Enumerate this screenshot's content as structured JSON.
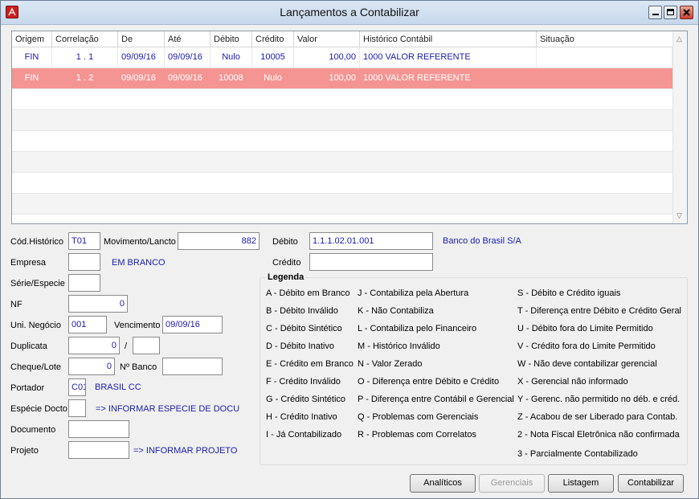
{
  "window": {
    "title": "Lançamentos a Contabilizar"
  },
  "grid": {
    "columns": [
      "Origem",
      "Correlação",
      "De",
      "Até",
      "Débito",
      "Crédito",
      "Valor",
      "Histórico Contábil",
      "Situação"
    ],
    "rows": [
      {
        "origem": "FIN",
        "correlacao": "1 . 1",
        "de": "09/09/16",
        "ate": "09/09/16",
        "debito": "Nulo",
        "credito": "10005",
        "valor": "100,00",
        "historico": "1000  VALOR REFERENTE",
        "situacao": ""
      },
      {
        "origem": "FIN",
        "correlacao": "1      . 2",
        "de": "09/09/16",
        "ate": "09/09/16",
        "debito": "10008",
        "credito": "Nulo",
        "valor": "100,00",
        "historico": "1000  VALOR REFERENTE",
        "situacao": ""
      }
    ]
  },
  "form": {
    "cod_historico": {
      "label": "Cód.Histórico",
      "value": "T01"
    },
    "movimento_lancto": {
      "label": "Movimento/Lancto",
      "value": "882"
    },
    "debito": {
      "label": "Débito",
      "value": "1.1.1.02.01.001",
      "desc": "Banco do Brasil S/A"
    },
    "credito": {
      "label": "Crédito",
      "value": ""
    },
    "empresa": {
      "label": "Empresa",
      "value": "",
      "desc": "EM BRANCO"
    },
    "serie_especie": {
      "label": "Série/Especie",
      "value": ""
    },
    "nf": {
      "label": "NF",
      "value": "0"
    },
    "uni_negocio": {
      "label": "Uni. Negócio",
      "value": "001"
    },
    "vencimento": {
      "label": "Vencimento",
      "value": "09/09/16"
    },
    "duplicata": {
      "label": "Duplicata",
      "value": "0",
      "slash": "/",
      "value2": ""
    },
    "cheque_lote": {
      "label": "Cheque/Lote",
      "value": "0"
    },
    "n_banco": {
      "label": "Nº Banco",
      "value": ""
    },
    "portador": {
      "label": "Portador",
      "value": "C01",
      "desc": "BRASIL CC"
    },
    "especie_docto": {
      "label": "Espécie Docto",
      "value": "",
      "desc": "=> INFORMAR ESPECIE DE DOCU"
    },
    "documento": {
      "label": "Documento",
      "value": ""
    },
    "projeto": {
      "label": "Projeto",
      "value": "",
      "desc": "=> INFORMAR PROJETO"
    }
  },
  "legend": {
    "title": "Legenda",
    "col1": [
      "A - Débito em Branco",
      "B - Débito Inválido",
      "C - Débito Sintético",
      "D - Débito Inativo",
      "E - Crédito em Branco",
      "F - Crédito Inválido",
      "G - Crédito Sintético",
      "H - Crédito Inativo",
      "I - Já Contabilizado"
    ],
    "col2": [
      "J - Contabiliza pela Abertura",
      "K - Não Contabiliza",
      "L - Contabiliza pelo Financeiro",
      "M - Histórico Inválido",
      "N - Valor Zerado",
      "O - Diferença entre Débito e Crédito",
      "P - Diferença entre Contábil e Gerencial",
      "Q - Problemas com Gerenciais",
      "R - Problemas com Correlatos"
    ],
    "col3": [
      "S - Débito e Crédito iguais",
      "T - Diferença entre Débito e Crédito Geral",
      "U - Débito fora do Limite Permitido",
      "V - Crédito fora do Limite Permitido",
      "W - Não deve contabilizar gerencial",
      "X - Gerencial não informado",
      "Y - Gerenc. não permitido no déb. e créd.",
      "Z - Acabou de ser Liberado para Contab.",
      "2 - Nota Fiscal Eletrônica não confirmada",
      "3 - Parcialmente Contabilizado"
    ]
  },
  "buttons": {
    "analiticos": "Analíticos",
    "gerenciais": "Gerenciais",
    "listagem": "Listagem",
    "contabilizar": "Contabilizar"
  },
  "colors": {
    "selected_row": "#f59593",
    "value_text": "#1b1bb0"
  }
}
